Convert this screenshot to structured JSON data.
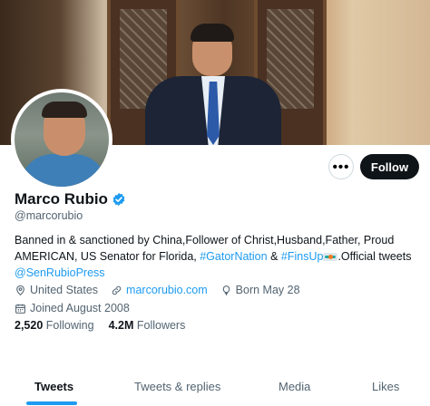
{
  "profile": {
    "name": "Marco Rubio",
    "handle": "@marcorubio",
    "bio": {
      "line1": "Banned in & sanctioned by China,Follower of Christ,Husband,Father, Proud",
      "line2_prefix": "AMERICAN, US Senator for Florida, ",
      "hashtag1": "#GatorNation",
      "amp": " & ",
      "hashtag2": "#FinsUp",
      "line2_suffix": ".Official tweets",
      "mention": "@SenRubioPress"
    },
    "location": "United States",
    "website": "marcorubio.com",
    "birthday": "Born May 28",
    "joined": "Joined August 2008",
    "following_count": "2,520",
    "following_label": "Following",
    "followers_count": "4.2M",
    "followers_label": "Followers"
  },
  "actions": {
    "more_label": "•••",
    "follow_label": "Follow"
  },
  "tabs": [
    {
      "label": "Tweets",
      "active": true
    },
    {
      "label": "Tweets & replies",
      "active": false
    },
    {
      "label": "Media",
      "active": false
    },
    {
      "label": "Likes",
      "active": false
    }
  ],
  "icons": {
    "verified": "verified-badge-icon",
    "location": "location-pin-icon",
    "website": "link-icon",
    "birthday": "balloon-icon",
    "joined": "calendar-icon",
    "flag": "dolphins-flag-emoji"
  },
  "colors": {
    "accent": "#1d9bf0",
    "text": "#0f1419",
    "muted": "#536471",
    "follow_button": "#0f1419"
  }
}
